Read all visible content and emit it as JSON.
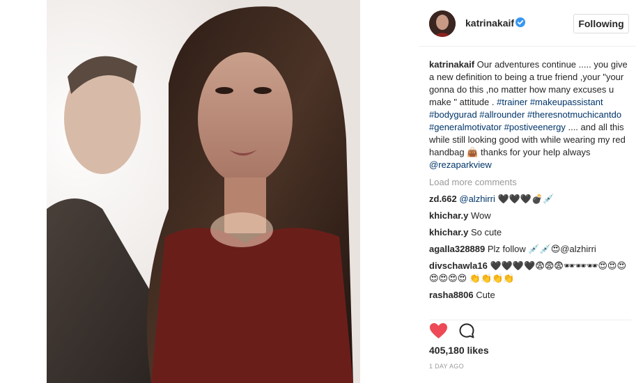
{
  "post": {
    "username": "katrinakaif",
    "follow_label": "Following",
    "caption": {
      "username": "katrinakaif",
      "text_1": "Our adventures continue ..... you give a new definition to being a true friend ,your \"your gonna do this ,no matter how many excuses u make \" attitude .",
      "hashtags": "#trainer #makeupassistant #bodygurad #allrounder #theresnotmuchicantdo #generalmotivator #postiveenergy",
      "text_2": ".... and all this while still looking good with while wearing my red handbag 👜 thanks for your help always",
      "mention": "@rezaparkview"
    },
    "load_more": "Load more comments",
    "comments": [
      {
        "user": "zd.662",
        "mention": "@alzhirri",
        "text": "🖤🖤🖤💣💉"
      },
      {
        "user": "khichar.y",
        "mention": "",
        "text": "Wow"
      },
      {
        "user": "khichar.y",
        "mention": "",
        "text": "So cute"
      },
      {
        "user": "agalla328889",
        "mention": "",
        "text": "Plz follow 💉💉😍@alzhirri"
      },
      {
        "user": "divschawla16",
        "mention": "",
        "text": "🖤🖤🖤🖤😨😨😨🕶🕶🕶😍😍😍😍😍😍😍 👏👏👏👏"
      },
      {
        "user": "rasha8806",
        "mention": "",
        "text": "Cute"
      }
    ],
    "likes": "405,180 likes",
    "time": "1 DAY AGO"
  },
  "icons": {
    "verified": "verified-badge-icon",
    "like": "heart-icon",
    "comment": "comment-bubble-icon"
  },
  "colors": {
    "link": "#003569",
    "verified": "#3897f0",
    "heart": "#ed4956",
    "muted": "#999999"
  }
}
